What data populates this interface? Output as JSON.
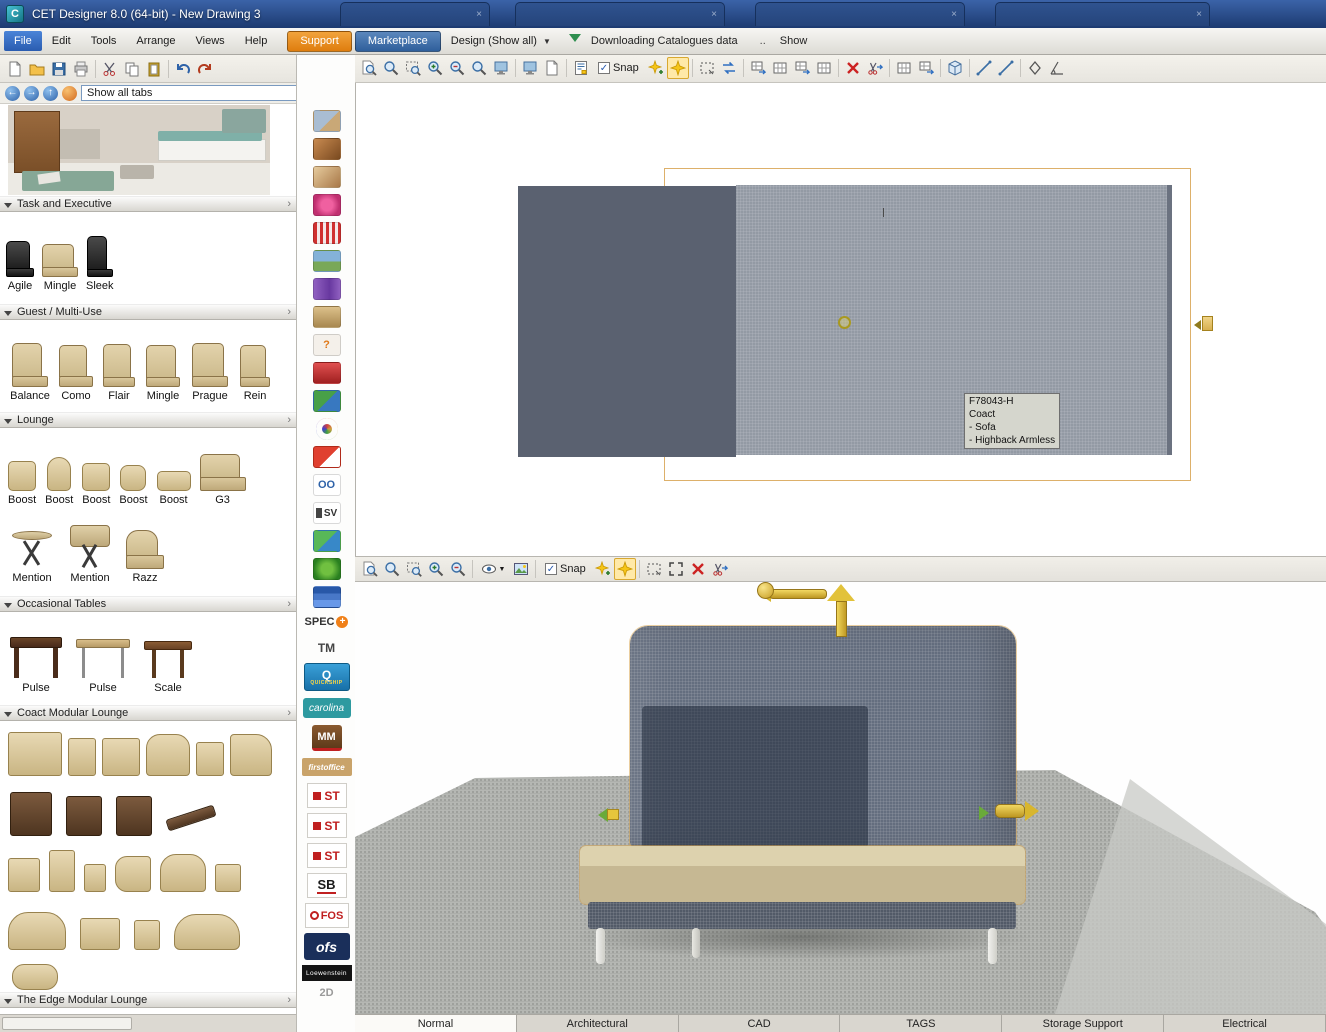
{
  "titlebar": {
    "app_title": "CET Designer 8.0 (64-bit) - New Drawing 3"
  },
  "menubar": {
    "menus": [
      "File",
      "Edit",
      "Tools",
      "Arrange",
      "Views",
      "Help"
    ],
    "support_label": "Support",
    "marketplace_label": "Marketplace",
    "design_dropdown_label": "Design (Show all)",
    "status_text": "Downloading Catalogues data",
    "dots": "..",
    "show_label": "Show"
  },
  "navbar": {
    "tabs_dropdown_value": "Show all tabs"
  },
  "viewport2d": {
    "snap_label": "Snap"
  },
  "viewport3d": {
    "snap_label": "Snap"
  },
  "tooltip": {
    "lines": [
      "F78043-H",
      "Coact",
      "- Sofa",
      "- Highback Armless"
    ]
  },
  "sidebar": {
    "sections": [
      {
        "title": "Task and Executive",
        "items": [
          "Agile",
          "Mingle",
          "Sleek"
        ]
      },
      {
        "title": "Guest / Multi-Use",
        "items": [
          "Balance",
          "Como",
          "Flair",
          "Mingle",
          "Prague",
          "Rein"
        ]
      },
      {
        "title": "Lounge",
        "items": [
          "Boost",
          "Boost",
          "Boost",
          "Boost",
          "Boost",
          "G3",
          "Mention",
          "Mention",
          "Razz"
        ]
      },
      {
        "title": "Occasional Tables",
        "items": [
          "Pulse",
          "Pulse",
          "Scale"
        ]
      },
      {
        "title": "Coact Modular Lounge",
        "items": []
      },
      {
        "title": "The Edge Modular Lounge",
        "items": []
      }
    ]
  },
  "strip": {
    "spec": "SPEC",
    "plus": "+",
    "tm": "TM",
    "quickship_q": "Q",
    "quickship": "QUICKSHIP",
    "carolina": "carolina",
    "mm": "MM",
    "firstoffice": "firstoffice",
    "st": "ST",
    "sb": "SB",
    "fos": "FOS",
    "ofs": "ofs",
    "loewenstein": "Loewenstein",
    "partial_2d": "2D"
  },
  "bottom_tabs": [
    "Normal",
    "Architectural",
    "CAD",
    "TAGS",
    "Storage Support",
    "Electrical"
  ],
  "colors": {
    "support_orange": "#e8891c",
    "marketplace_blue": "#3a699f",
    "selection_tan": "#d8a650",
    "sofa_blue": "#5d6779",
    "seat_tan": "#c6b893"
  }
}
